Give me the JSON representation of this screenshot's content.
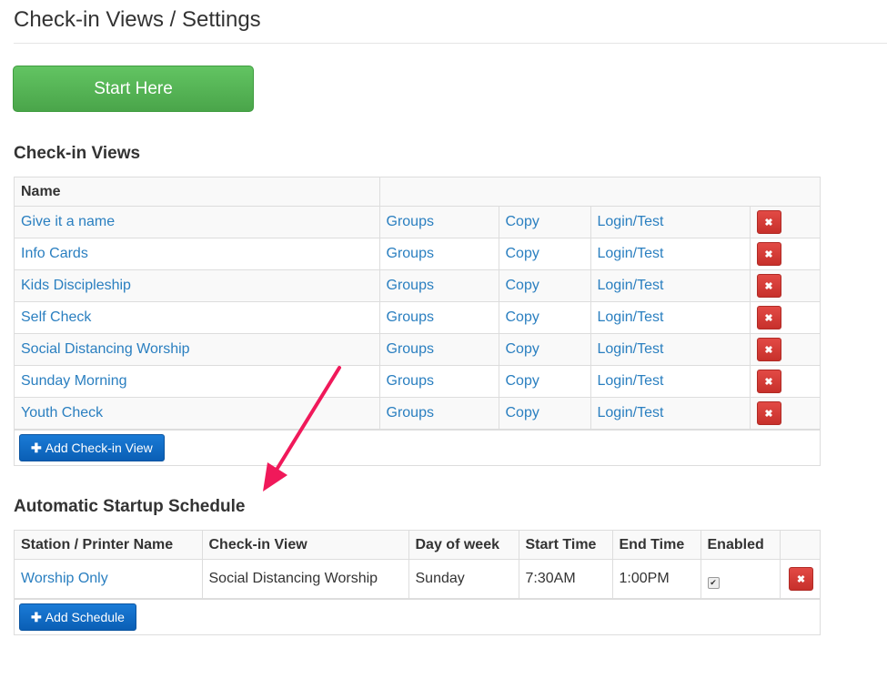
{
  "page": {
    "title": "Check-in Views / Settings"
  },
  "start_button": {
    "label": "Start Here"
  },
  "checkin_views": {
    "heading": "Check-in Views",
    "columns": [
      "Name",
      ""
    ],
    "rows": [
      {
        "name": "Give it a name",
        "groups": "Groups",
        "copy": "Copy",
        "login": "Login/Test"
      },
      {
        "name": "Info Cards",
        "groups": "Groups",
        "copy": "Copy",
        "login": "Login/Test"
      },
      {
        "name": "Kids Discipleship",
        "groups": "Groups",
        "copy": "Copy",
        "login": "Login/Test"
      },
      {
        "name": "Self Check",
        "groups": "Groups",
        "copy": "Copy",
        "login": "Login/Test"
      },
      {
        "name": "Social Distancing Worship",
        "groups": "Groups",
        "copy": "Copy",
        "login": "Login/Test"
      },
      {
        "name": "Sunday Morning",
        "groups": "Groups",
        "copy": "Copy",
        "login": "Login/Test"
      },
      {
        "name": "Youth Check",
        "groups": "Groups",
        "copy": "Copy",
        "login": "Login/Test"
      }
    ],
    "delete_icon": "x-icon",
    "add_button": "Add Check-in View"
  },
  "schedule": {
    "heading": "Automatic Startup Schedule",
    "columns": [
      "Station / Printer Name",
      "Check-in View",
      "Day of week",
      "Start Time",
      "End Time",
      "Enabled",
      ""
    ],
    "rows": [
      {
        "station": "Worship Only",
        "view": "Social Distancing Worship",
        "day": "Sunday",
        "start": "7:30AM",
        "end": "1:00PM",
        "enabled": true
      }
    ],
    "add_button": "Add Schedule"
  },
  "colors": {
    "link": "#2a7fc0",
    "success": "#5cb85c",
    "danger": "#d9534f",
    "primary": "#0a6fcf",
    "annotation_arrow": "#f0195a"
  }
}
